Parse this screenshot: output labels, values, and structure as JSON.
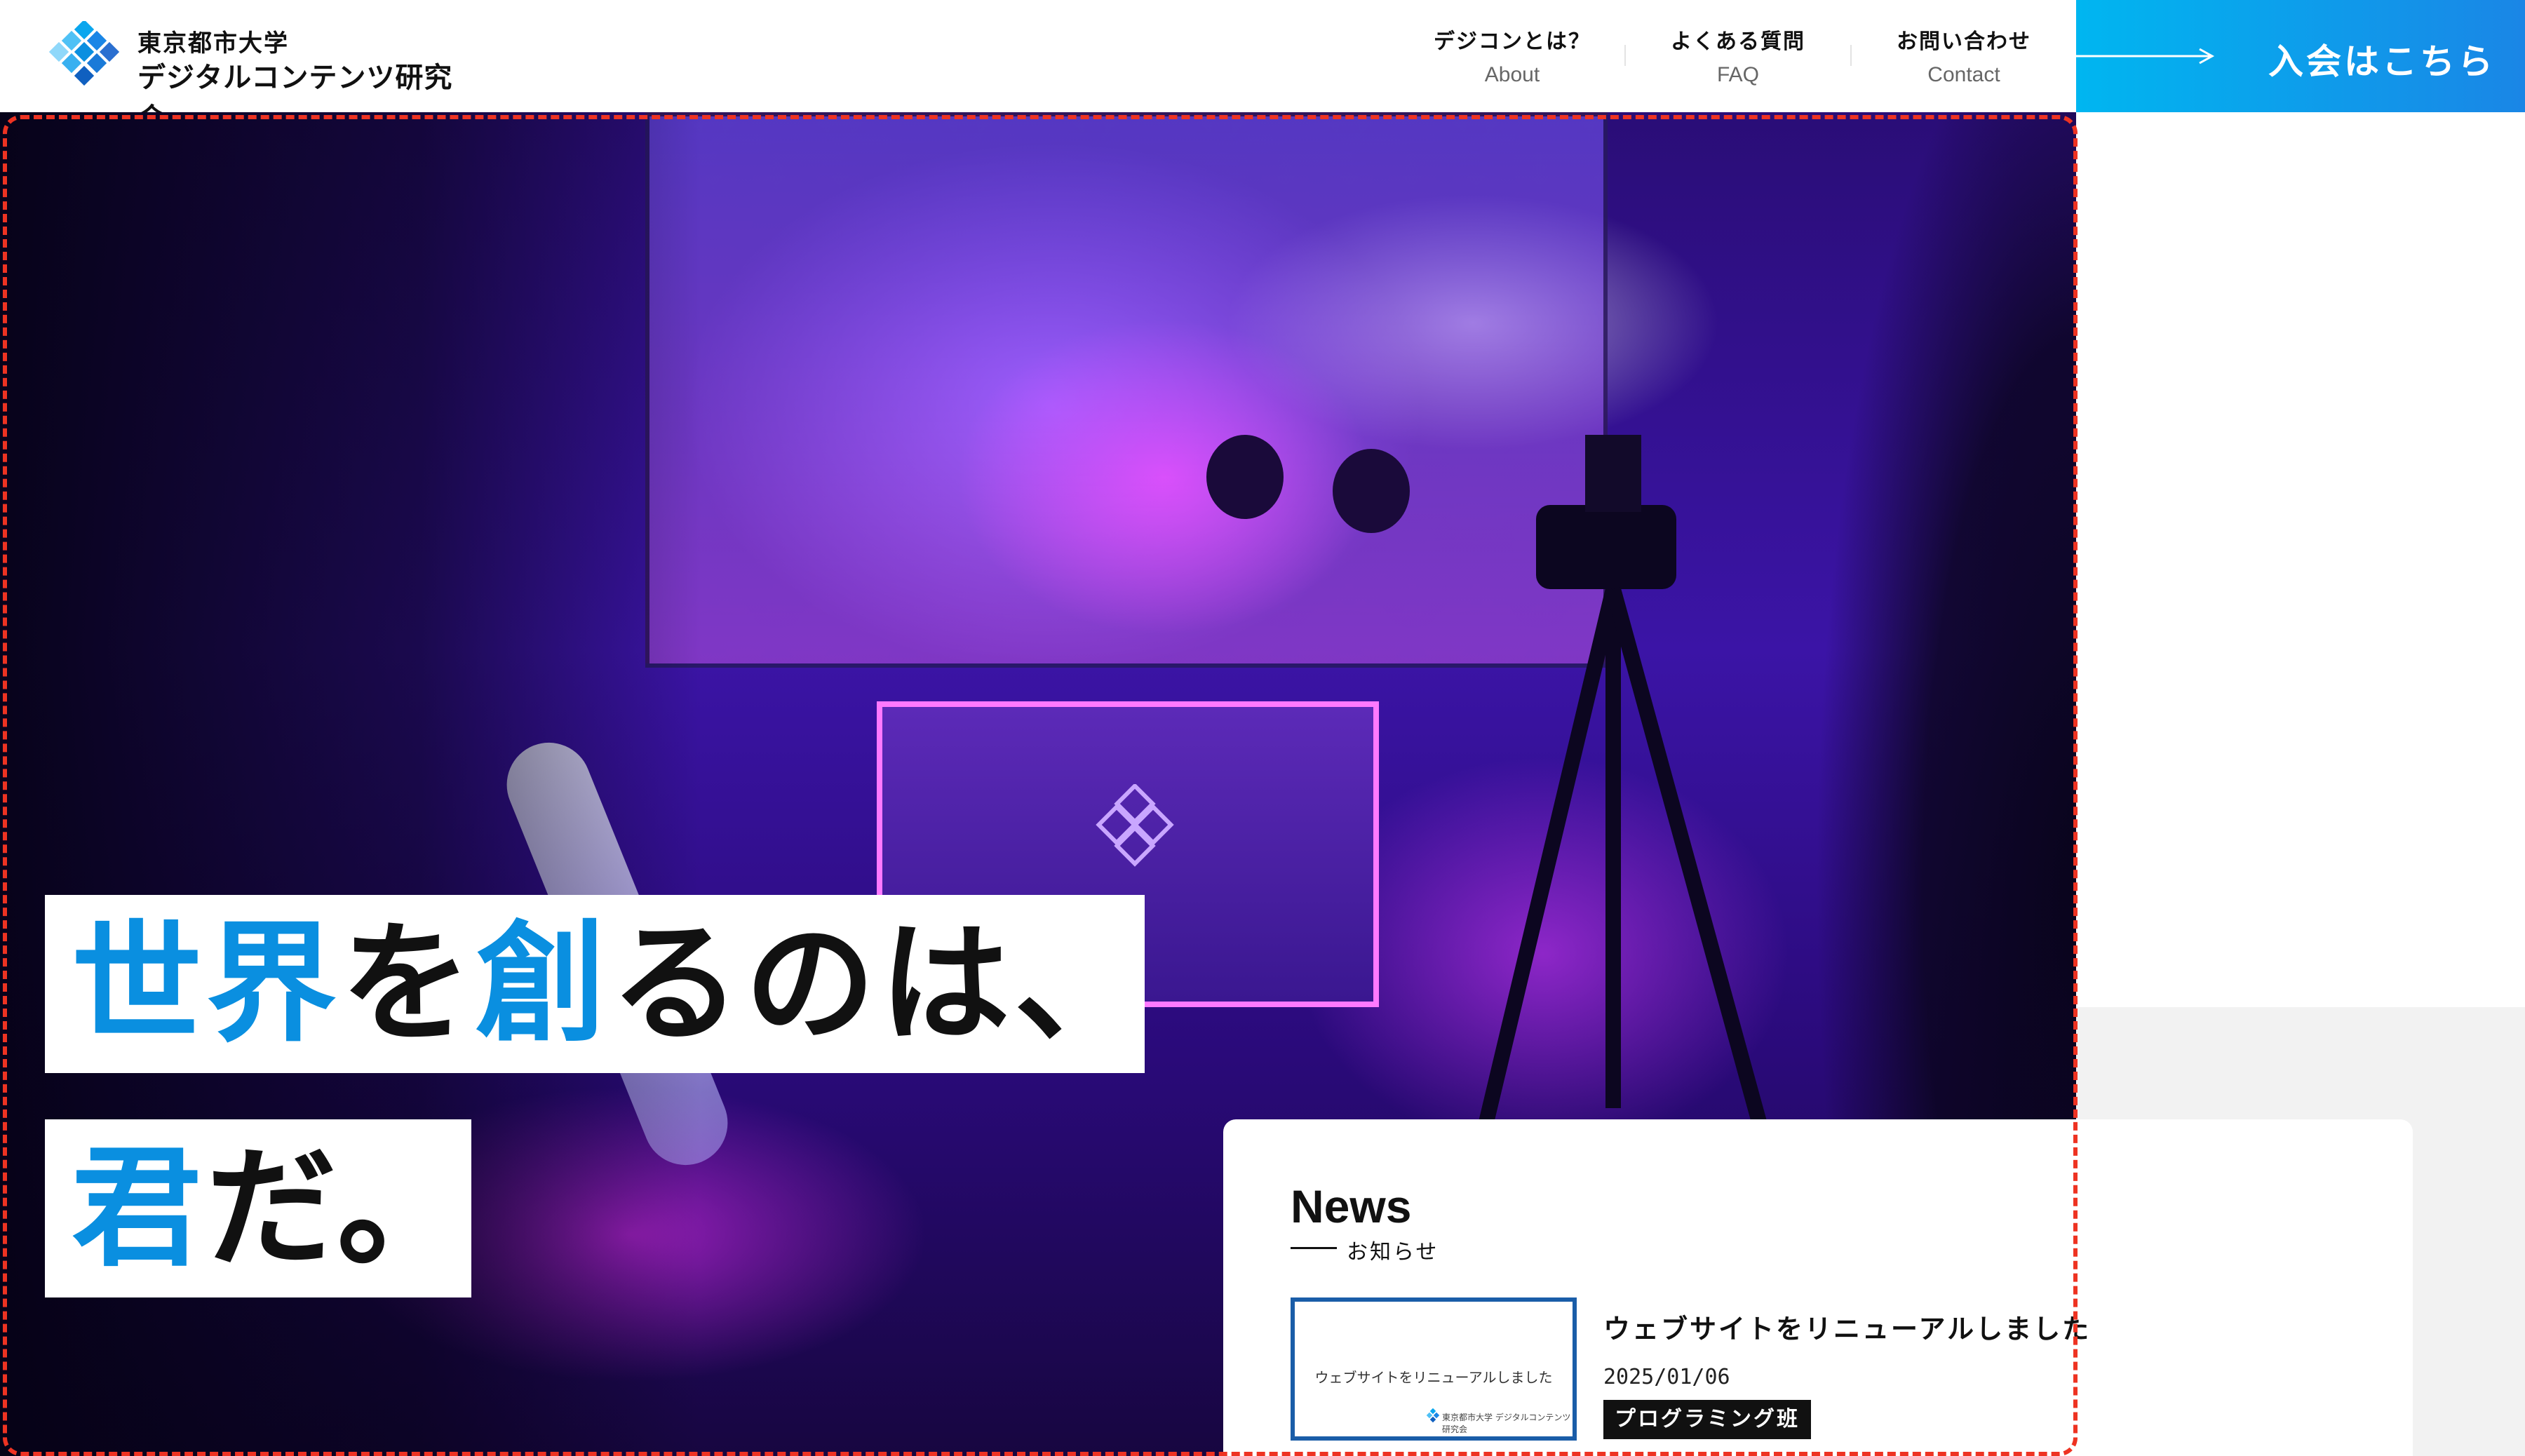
{
  "header": {
    "logo_line1": "東京都市大学",
    "logo_line2": "デジタルコンテンツ研究会",
    "nav": [
      {
        "jp": "デジコンとは？",
        "en": "About"
      },
      {
        "jp": "よくある質問",
        "en": "FAQ"
      },
      {
        "jp": "お問い合わせ",
        "en": "Contact"
      }
    ],
    "join_label": "入会はこちら"
  },
  "hero": {
    "catch1": {
      "p1": "世界",
      "p2": "を",
      "p3": "創",
      "p4": "るのは、"
    },
    "catch2": {
      "p1": "君",
      "p2": "だ。"
    }
  },
  "news": {
    "title": "News",
    "subtitle": "お知らせ",
    "items": [
      {
        "thumb_text": "ウェブサイトをリニューアルしました",
        "thumb_logo": "東京都市大学 デジタルコンテンツ研究会",
        "headline": "ウェブサイトをリニューアルしました",
        "date": "2025/01/06",
        "tag": "プログラミング班"
      }
    ]
  },
  "colors": {
    "accent_blue": "#0a8fe0",
    "join_gradient_start": "#00b6f0",
    "join_gradient_end": "#1a86e6",
    "annotation_frame": "#ee3322"
  }
}
